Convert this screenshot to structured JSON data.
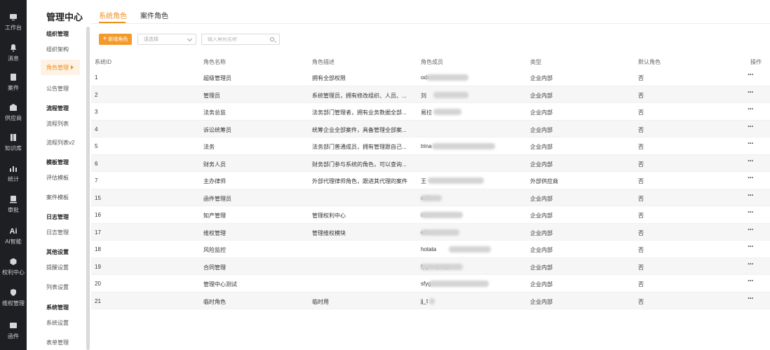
{
  "rail": [
    {
      "label": "工作台",
      "icon": "monitor-icon"
    },
    {
      "label": "消息",
      "icon": "bell-icon"
    },
    {
      "label": "案件",
      "icon": "case-icon"
    },
    {
      "label": "供应商",
      "icon": "building-icon"
    },
    {
      "label": "知识库",
      "icon": "book-icon"
    },
    {
      "label": "统计",
      "icon": "chart-icon"
    },
    {
      "label": "审批",
      "icon": "approval-icon"
    },
    {
      "label": "AI智能",
      "icon": "ai-icon",
      "glyph": "Ai"
    },
    {
      "label": "权利中心",
      "icon": "rights-icon"
    },
    {
      "label": "维权管理",
      "icon": "shield-icon"
    },
    {
      "label": "函件",
      "icon": "letter-icon"
    }
  ],
  "subnav": {
    "title": "管理中心",
    "groups": [
      {
        "title": "组织管理",
        "items": [
          "组织架构",
          "角色管理",
          "公告管理"
        ]
      },
      {
        "title": "流程管理",
        "items": [
          "流程列表",
          "流程列表v2"
        ]
      },
      {
        "title": "模板管理",
        "items": [
          "评估模板",
          "案件模板"
        ]
      },
      {
        "title": "日志管理",
        "items": [
          "日志管理"
        ]
      },
      {
        "title": "其他设置",
        "items": [
          "提醒设置",
          "列表设置"
        ]
      },
      {
        "title": "系统管理",
        "items": [
          "系统设置",
          "表单管理"
        ]
      }
    ],
    "active": "角色管理"
  },
  "tabs": [
    "系统角色",
    "案件角色"
  ],
  "toolbar": {
    "new_label": "新增角色",
    "select_placeholder": "请选择",
    "search_placeholder": "输入角色名称"
  },
  "table": {
    "headers": [
      "系统ID",
      "角色名称",
      "角色描述",
      "角色成员",
      "类型",
      "默认角色",
      "操作"
    ],
    "rows": [
      {
        "id": "1",
        "name": "超级管理员",
        "desc": "拥有全部权限",
        "members": "odemo",
        "type": "企业内部",
        "def": "否"
      },
      {
        "id": "2",
        "name": "管理员",
        "desc": "系统管理员，拥有修改组织、人员、...",
        "members": "刘",
        "type": "企业内部",
        "def": "否"
      },
      {
        "id": "3",
        "name": "法务总监",
        "desc": "法务部门管理者，拥有业务数据全部...",
        "members": "易拉",
        "type": "企业内部",
        "def": "否"
      },
      {
        "id": "4",
        "name": "诉讼统筹员",
        "desc": "统筹企业全部案件，具备管理全部案...",
        "members": "",
        "type": "企业内部",
        "def": "否"
      },
      {
        "id": "5",
        "name": "法务",
        "desc": "法务部门普通成员，拥有管理跟自己...",
        "members": "trina",
        "type": "企业内部",
        "def": "否"
      },
      {
        "id": "6",
        "name": "财务人员",
        "desc": "财务部门参与系统的角色，可以查询...",
        "members": "",
        "type": "企业内部",
        "def": "否"
      },
      {
        "id": "7",
        "name": "主办律师",
        "desc": "外部代理律师角色，跟进其代理的案件",
        "members": "王",
        "type": "外部供应商",
        "def": "否"
      },
      {
        "id": "15",
        "name": "函件管理员",
        "desc": "",
        "members": "enlin",
        "type": "企业内部",
        "def": "否"
      },
      {
        "id": "16",
        "name": "知产管理",
        "desc": "管理权利中心",
        "members": "irom",
        "type": "企业内部",
        "def": "否"
      },
      {
        "id": "17",
        "name": "维权管理",
        "desc": "管理维权模块",
        "members": "etirom",
        "type": "企业内部",
        "def": "否"
      },
      {
        "id": "18",
        "name": "风险监控",
        "desc": "",
        "members": "hotata",
        "type": "企业内部",
        "def": "否"
      },
      {
        "id": "19",
        "name": "合同管理",
        "desc": "",
        "members": "fygroup;opp",
        "type": "企业内部",
        "def": "否"
      },
      {
        "id": "20",
        "name": "管理中心测试",
        "desc": "",
        "members": "sfyg",
        "type": "企业内部",
        "def": "否"
      },
      {
        "id": "21",
        "name": "临时角色",
        "desc": "临时用",
        "members": "jj_t",
        "type": "企业内部",
        "def": "否"
      }
    ],
    "op_glyph": "···"
  }
}
